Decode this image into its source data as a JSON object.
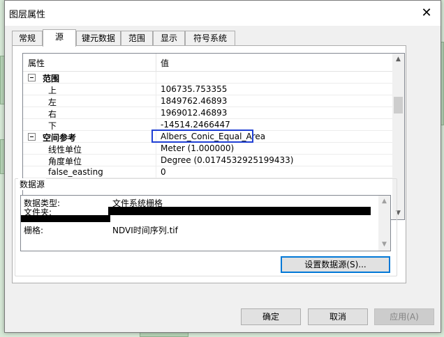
{
  "dialog": {
    "title": "图层属性",
    "close_glyph": "✕"
  },
  "tabs": [
    {
      "label": "常规",
      "active": false
    },
    {
      "label": "源",
      "active": true
    },
    {
      "label": "键元数据",
      "active": false
    },
    {
      "label": "范围",
      "active": false
    },
    {
      "label": "显示",
      "active": false
    },
    {
      "label": "符号系统",
      "active": false
    }
  ],
  "property_grid": {
    "header_property": "属性",
    "header_value": "值",
    "rows": [
      {
        "type": "category",
        "name": "范围",
        "value": "",
        "expanded": true
      },
      {
        "type": "item",
        "name": "上",
        "value": "106735.753355"
      },
      {
        "type": "item",
        "name": "左",
        "value": "1849762.46893"
      },
      {
        "type": "item",
        "name": "右",
        "value": "1969012.46893"
      },
      {
        "type": "item",
        "name": "下",
        "value": "-14514.2466447"
      },
      {
        "type": "category",
        "name": "空间参考",
        "value": "Albers_Conic_Equal_Area",
        "expanded": true,
        "highlighted": true
      },
      {
        "type": "item",
        "name": "线性单位",
        "value": "Meter (1.000000)"
      },
      {
        "type": "item",
        "name": "角度单位",
        "value": "Degree (0.0174532925199433)"
      },
      {
        "type": "item",
        "name": "false_easting",
        "value": "0"
      }
    ],
    "scroll_up": "▲",
    "scroll_down": "▼"
  },
  "data_source": {
    "legend": "数据源",
    "lines": [
      {
        "key": "数据类型:",
        "value": "文件系统栅格"
      },
      {
        "key": "文件夹:",
        "value": ""
      },
      {
        "key": "栅格:",
        "value": "NDVI时间序列.tif"
      }
    ],
    "set_source_button": "设置数据源(S)...",
    "scroll_up": "▲",
    "scroll_down": "▼"
  },
  "footer": {
    "ok": "确定",
    "cancel": "取消",
    "apply": "应用(A)"
  },
  "colors": {
    "highlight_border": "#1f3fd4",
    "focus_border": "#0078d7"
  }
}
